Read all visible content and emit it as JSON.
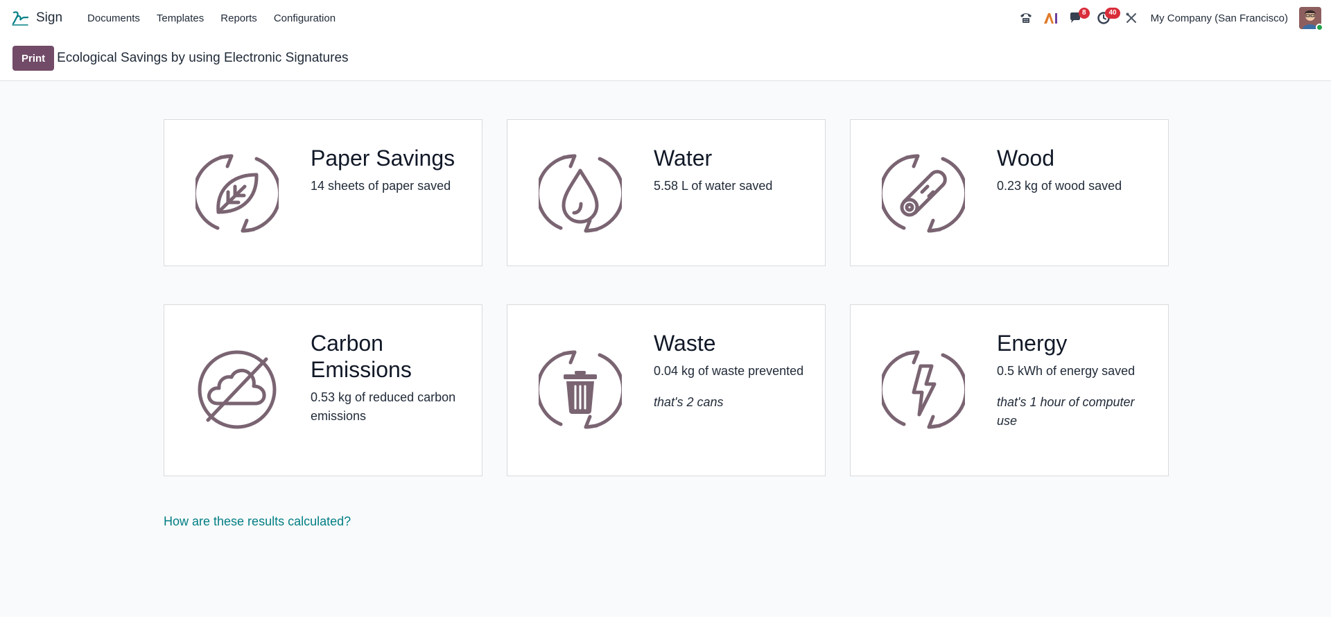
{
  "app": {
    "name": "Sign",
    "logo_icon": "sign-logo-icon"
  },
  "menu": [
    "Documents",
    "Templates",
    "Reports",
    "Configuration"
  ],
  "systray": {
    "phone_icon": "phone-icon",
    "ai_icon": "ai-icon",
    "messages_badge": "8",
    "activities_badge": "40",
    "tools_icon": "tools-icon",
    "company": "My Company (San Francisco)"
  },
  "control_panel": {
    "print_label": "Print",
    "title": "Ecological Savings by using Electronic Signatures"
  },
  "cards": [
    {
      "title": "Paper Savings",
      "value": "14 sheets of paper saved",
      "note": "",
      "icon": "leaf-recycle-icon"
    },
    {
      "title": "Water",
      "value": "5.58 L of water saved",
      "note": "",
      "icon": "water-drop-recycle-icon"
    },
    {
      "title": "Wood",
      "value": "0.23 kg of wood saved",
      "note": "",
      "icon": "wood-log-recycle-icon"
    },
    {
      "title": "Carbon Emissions",
      "value": "0.53 kg of reduced carbon emissions",
      "note": "",
      "icon": "cloud-crossed-icon"
    },
    {
      "title": "Waste",
      "value": "0.04 kg of waste prevented",
      "note": "that's 2 cans",
      "icon": "trash-recycle-icon"
    },
    {
      "title": "Energy",
      "value": "0.5 kWh of energy saved",
      "note": "that's 1 hour of computer use",
      "icon": "lightning-recycle-icon"
    }
  ],
  "help_link": "How are these results calculated?",
  "colors": {
    "brand": "#714b67",
    "icon": "#7a6472",
    "link": "#017e84",
    "badge": "#d92d3a"
  }
}
